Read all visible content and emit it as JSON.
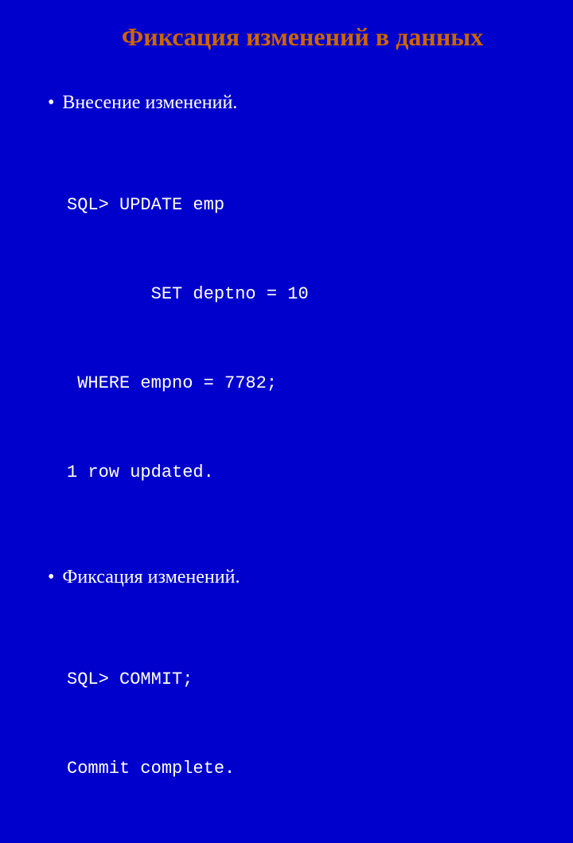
{
  "slide": {
    "title": "Фиксация изменений в данных",
    "bullets": [
      {
        "text": "Внесение изменений."
      },
      {
        "text": "Фиксация изменений."
      }
    ],
    "code_blocks": [
      {
        "lines": [
          "SQL> UPDATE emp",
          "        SET deptno = 10",
          " WHERE empno = 7782;",
          "1 row updated."
        ]
      },
      {
        "lines": [
          "SQL> COMMIT;",
          "Commit complete."
        ]
      }
    ]
  }
}
